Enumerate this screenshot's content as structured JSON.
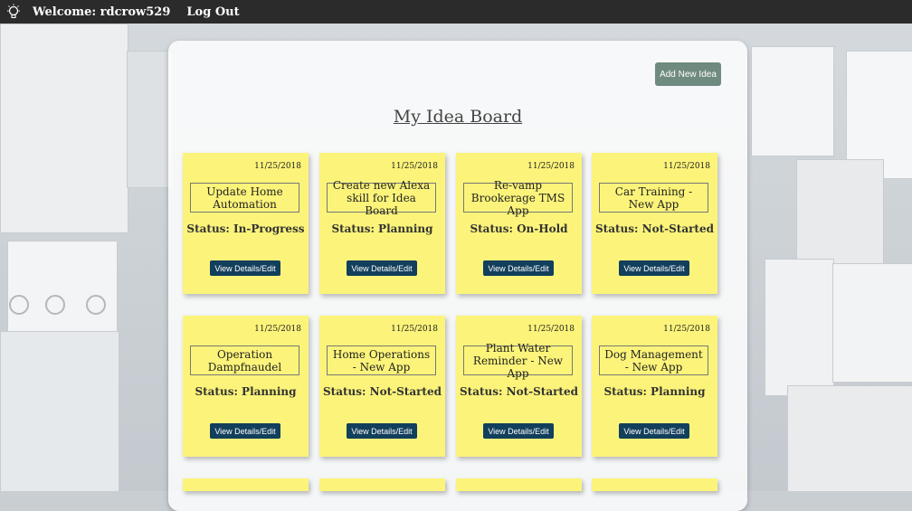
{
  "topbar": {
    "welcome": "Welcome: rdcrow529",
    "logout": "Log Out",
    "logo_icon": "lightbulb-icon"
  },
  "board": {
    "title": "My Idea Board",
    "add_button": "Add New Idea",
    "view_button": "View Details/Edit",
    "ideas": [
      {
        "date": "11/25/2018",
        "title": "Update Home Automation",
        "status": "Status: In-Progress"
      },
      {
        "date": "11/25/2018",
        "title": "Create new Alexa skill for Idea Board",
        "status": "Status: Planning"
      },
      {
        "date": "11/25/2018",
        "title": "Re-vamp Brookerage TMS App",
        "status": "Status: On-Hold"
      },
      {
        "date": "11/25/2018",
        "title": "Car Training - New App",
        "status": "Status: Not-Started"
      },
      {
        "date": "11/25/2018",
        "title": "Operation Dampfnaudel",
        "status": "Status: Planning"
      },
      {
        "date": "11/25/2018",
        "title": "Home Operations - New App",
        "status": "Status: Not-Started"
      },
      {
        "date": "11/25/2018",
        "title": "Plant Water Reminder - New App",
        "status": "Status: Not-Started"
      },
      {
        "date": "11/25/2018",
        "title": "Dog Management - New App",
        "status": "Status: Planning"
      }
    ]
  },
  "colors": {
    "note": "#fcf47a",
    "button": "#123f5c",
    "add_button": "#6f8b7f",
    "topbar": "#2b2b2b"
  }
}
